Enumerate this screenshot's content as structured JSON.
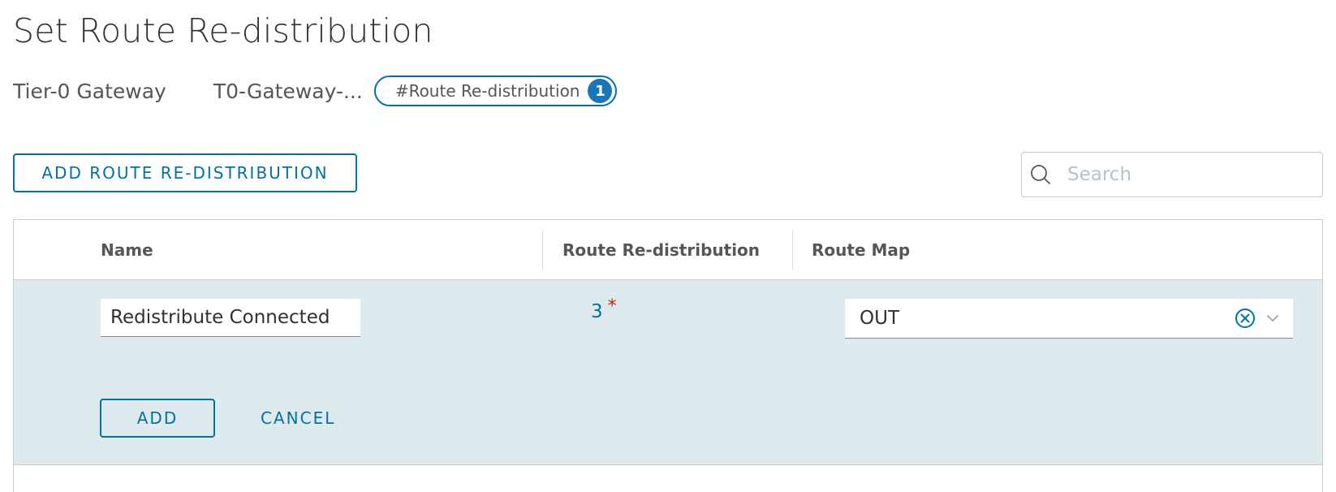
{
  "page": {
    "title": "Set Route Re-distribution"
  },
  "context": {
    "label": "Tier-0 Gateway",
    "gateway_name": "T0-Gateway-...",
    "pill_label": "#Route Re-distribution",
    "pill_count": "1"
  },
  "toolbar": {
    "add_label": "ADD ROUTE RE-DISTRIBUTION",
    "search_placeholder": "Search"
  },
  "grid": {
    "columns": [
      "Name",
      "Route Re-distribution",
      "Route Map"
    ],
    "edit_row": {
      "name_value": "Redistribute Connected",
      "route_redistribution_count": "3",
      "required_marker": "*",
      "route_map_value": "OUT",
      "add_label": "ADD",
      "cancel_label": "CANCEL"
    }
  },
  "colors": {
    "accent": "#0072a3",
    "badge": "#1b75bb",
    "edit_row_bg": "#deeaee",
    "required": "#c92100"
  },
  "icons": {
    "search": "search-icon",
    "clear": "clear-circle-icon",
    "dropdown": "chevron-down-icon"
  }
}
